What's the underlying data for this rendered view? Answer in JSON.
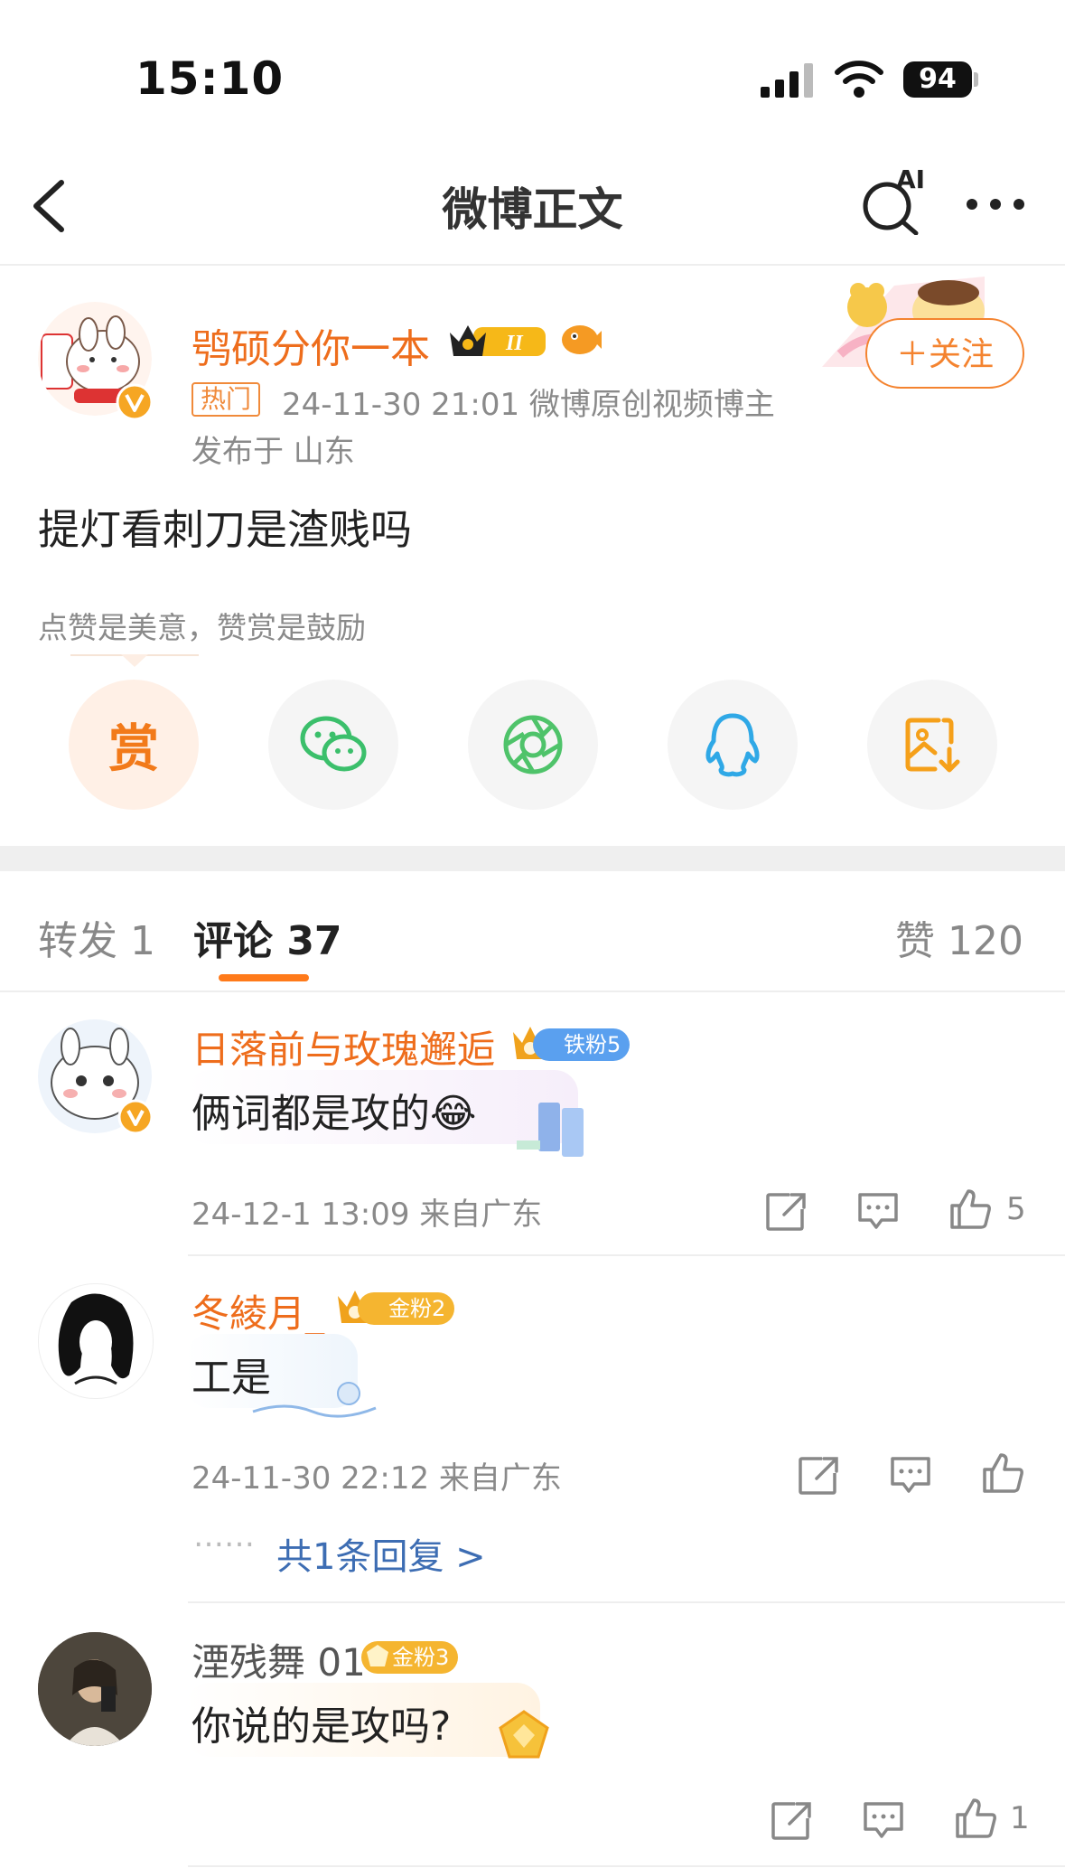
{
  "status_bar": {
    "time": "15:10",
    "battery": "94"
  },
  "nav": {
    "title": "微博正文",
    "ai_label": "AI"
  },
  "post": {
    "author": "鸮硕分你一本",
    "badge_level": "II",
    "hot_label": "热门",
    "meta": "24-11-30 21:01  微博原创视频博主",
    "location": "发布于 山东",
    "follow_label": "＋关注",
    "text": "提灯看刺刀是渣贱吗",
    "reward_hint": "点赞是美意，赞赏是鼓励",
    "reward_icon_text": "赏"
  },
  "share_items": [
    "reward-icon",
    "wechat-icon",
    "moments-icon",
    "qq-icon",
    "save-image-icon"
  ],
  "tabs": {
    "repost": "转发 1",
    "comments": "评论 37",
    "likes": "赞 120"
  },
  "colors": {
    "accent": "#ff7a1a",
    "link": "#3d6db3",
    "name": "#ee6d1c"
  },
  "comments": [
    {
      "name": "日落前与玫瑰邂逅",
      "fan_badge": "铁粉5",
      "text": "俩词都是攻的😂",
      "meta": "24-12-1 13:09  来自广东",
      "likes": "5"
    },
    {
      "name": "冬綾月_",
      "fan_badge": "金粉2",
      "text": "工是",
      "meta": "24-11-30 22:12  来自广东",
      "likes": "",
      "reply_link": "共1条回复 >",
      "reply_dots": "……"
    },
    {
      "name": "湮残舞 01",
      "fan_badge": "金粉3",
      "text": "你说的是攻吗?",
      "meta": "",
      "likes": "1"
    }
  ]
}
